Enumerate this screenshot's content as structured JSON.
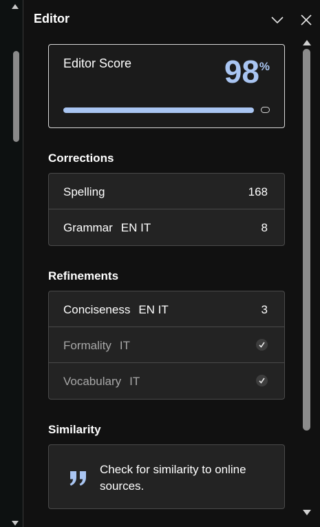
{
  "header": {
    "title": "Editor"
  },
  "score": {
    "label": "Editor Score",
    "value": "98",
    "unit": "%",
    "progress_fraction": 0.98
  },
  "corrections": {
    "title": "Corrections",
    "items": [
      {
        "label": "Spelling",
        "lang": "",
        "count": "168"
      },
      {
        "label": "Grammar",
        "lang": "EN IT",
        "count": "8"
      }
    ]
  },
  "refinements": {
    "title": "Refinements",
    "items": [
      {
        "label": "Conciseness",
        "lang": "EN IT",
        "count": "3",
        "state": "count"
      },
      {
        "label": "Formality",
        "lang": "IT",
        "count": "",
        "state": "done"
      },
      {
        "label": "Vocabulary",
        "lang": "IT",
        "count": "",
        "state": "done"
      }
    ]
  },
  "similarity": {
    "title": "Similarity",
    "text": "Check for similarity to online sources.",
    "icon": "quote-icon"
  },
  "colors": {
    "accent": "#a9c5f2",
    "background": "#111111",
    "card": "#232323"
  }
}
